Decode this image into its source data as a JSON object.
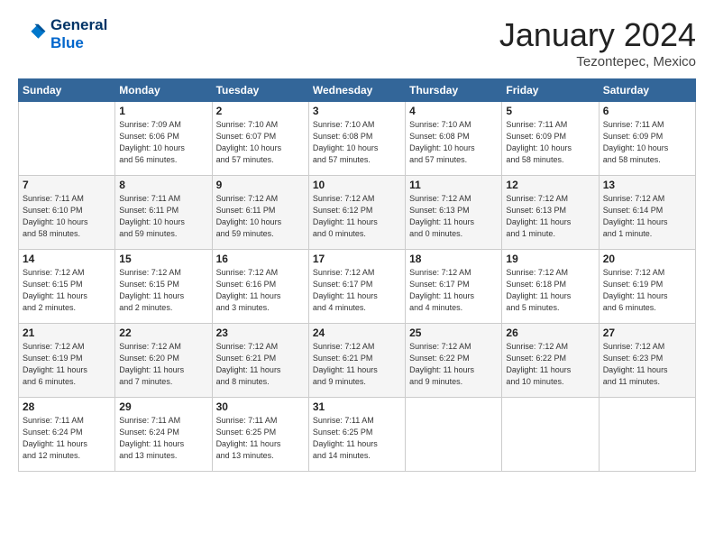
{
  "logo": {
    "line1": "General",
    "line2": "Blue"
  },
  "header": {
    "title": "January 2024",
    "location": "Tezontepec, Mexico"
  },
  "days_of_week": [
    "Sunday",
    "Monday",
    "Tuesday",
    "Wednesday",
    "Thursday",
    "Friday",
    "Saturday"
  ],
  "weeks": [
    [
      {
        "num": "",
        "info": ""
      },
      {
        "num": "1",
        "info": "Sunrise: 7:09 AM\nSunset: 6:06 PM\nDaylight: 10 hours\nand 56 minutes."
      },
      {
        "num": "2",
        "info": "Sunrise: 7:10 AM\nSunset: 6:07 PM\nDaylight: 10 hours\nand 57 minutes."
      },
      {
        "num": "3",
        "info": "Sunrise: 7:10 AM\nSunset: 6:08 PM\nDaylight: 10 hours\nand 57 minutes."
      },
      {
        "num": "4",
        "info": "Sunrise: 7:10 AM\nSunset: 6:08 PM\nDaylight: 10 hours\nand 57 minutes."
      },
      {
        "num": "5",
        "info": "Sunrise: 7:11 AM\nSunset: 6:09 PM\nDaylight: 10 hours\nand 58 minutes."
      },
      {
        "num": "6",
        "info": "Sunrise: 7:11 AM\nSunset: 6:09 PM\nDaylight: 10 hours\nand 58 minutes."
      }
    ],
    [
      {
        "num": "7",
        "info": "Sunrise: 7:11 AM\nSunset: 6:10 PM\nDaylight: 10 hours\nand 58 minutes."
      },
      {
        "num": "8",
        "info": "Sunrise: 7:11 AM\nSunset: 6:11 PM\nDaylight: 10 hours\nand 59 minutes."
      },
      {
        "num": "9",
        "info": "Sunrise: 7:12 AM\nSunset: 6:11 PM\nDaylight: 10 hours\nand 59 minutes."
      },
      {
        "num": "10",
        "info": "Sunrise: 7:12 AM\nSunset: 6:12 PM\nDaylight: 11 hours\nand 0 minutes."
      },
      {
        "num": "11",
        "info": "Sunrise: 7:12 AM\nSunset: 6:13 PM\nDaylight: 11 hours\nand 0 minutes."
      },
      {
        "num": "12",
        "info": "Sunrise: 7:12 AM\nSunset: 6:13 PM\nDaylight: 11 hours\nand 1 minute."
      },
      {
        "num": "13",
        "info": "Sunrise: 7:12 AM\nSunset: 6:14 PM\nDaylight: 11 hours\nand 1 minute."
      }
    ],
    [
      {
        "num": "14",
        "info": "Sunrise: 7:12 AM\nSunset: 6:15 PM\nDaylight: 11 hours\nand 2 minutes."
      },
      {
        "num": "15",
        "info": "Sunrise: 7:12 AM\nSunset: 6:15 PM\nDaylight: 11 hours\nand 2 minutes."
      },
      {
        "num": "16",
        "info": "Sunrise: 7:12 AM\nSunset: 6:16 PM\nDaylight: 11 hours\nand 3 minutes."
      },
      {
        "num": "17",
        "info": "Sunrise: 7:12 AM\nSunset: 6:17 PM\nDaylight: 11 hours\nand 4 minutes."
      },
      {
        "num": "18",
        "info": "Sunrise: 7:12 AM\nSunset: 6:17 PM\nDaylight: 11 hours\nand 4 minutes."
      },
      {
        "num": "19",
        "info": "Sunrise: 7:12 AM\nSunset: 6:18 PM\nDaylight: 11 hours\nand 5 minutes."
      },
      {
        "num": "20",
        "info": "Sunrise: 7:12 AM\nSunset: 6:19 PM\nDaylight: 11 hours\nand 6 minutes."
      }
    ],
    [
      {
        "num": "21",
        "info": "Sunrise: 7:12 AM\nSunset: 6:19 PM\nDaylight: 11 hours\nand 6 minutes."
      },
      {
        "num": "22",
        "info": "Sunrise: 7:12 AM\nSunset: 6:20 PM\nDaylight: 11 hours\nand 7 minutes."
      },
      {
        "num": "23",
        "info": "Sunrise: 7:12 AM\nSunset: 6:21 PM\nDaylight: 11 hours\nand 8 minutes."
      },
      {
        "num": "24",
        "info": "Sunrise: 7:12 AM\nSunset: 6:21 PM\nDaylight: 11 hours\nand 9 minutes."
      },
      {
        "num": "25",
        "info": "Sunrise: 7:12 AM\nSunset: 6:22 PM\nDaylight: 11 hours\nand 9 minutes."
      },
      {
        "num": "26",
        "info": "Sunrise: 7:12 AM\nSunset: 6:22 PM\nDaylight: 11 hours\nand 10 minutes."
      },
      {
        "num": "27",
        "info": "Sunrise: 7:12 AM\nSunset: 6:23 PM\nDaylight: 11 hours\nand 11 minutes."
      }
    ],
    [
      {
        "num": "28",
        "info": "Sunrise: 7:11 AM\nSunset: 6:24 PM\nDaylight: 11 hours\nand 12 minutes."
      },
      {
        "num": "29",
        "info": "Sunrise: 7:11 AM\nSunset: 6:24 PM\nDaylight: 11 hours\nand 13 minutes."
      },
      {
        "num": "30",
        "info": "Sunrise: 7:11 AM\nSunset: 6:25 PM\nDaylight: 11 hours\nand 13 minutes."
      },
      {
        "num": "31",
        "info": "Sunrise: 7:11 AM\nSunset: 6:25 PM\nDaylight: 11 hours\nand 14 minutes."
      },
      {
        "num": "",
        "info": ""
      },
      {
        "num": "",
        "info": ""
      },
      {
        "num": "",
        "info": ""
      }
    ]
  ]
}
